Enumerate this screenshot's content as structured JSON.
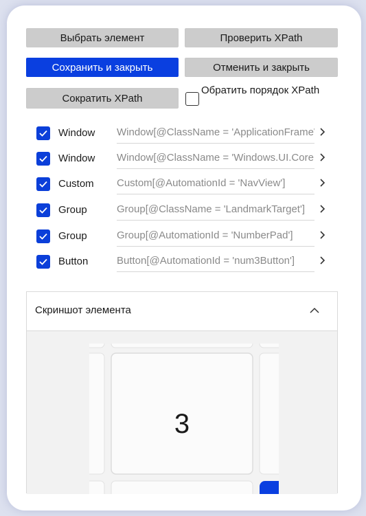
{
  "toolbar": {
    "select_element": "Выбрать элемент",
    "check_xpath": "Проверить XPath",
    "save_close": "Сохранить и закрыть",
    "cancel_close": "Отменить и закрыть",
    "shorten_xpath": "Сократить XPath",
    "reverse_label": "Обратить порядок XPath",
    "reverse_checked": false
  },
  "rows": [
    {
      "type": "Window",
      "path": "Window[@ClassName = 'ApplicationFrameWindow']",
      "checked": true
    },
    {
      "type": "Window",
      "path": "Window[@ClassName = 'Windows.UI.Core.CoreWindow']",
      "checked": true
    },
    {
      "type": "Custom",
      "path": "Custom[@AutomationId = 'NavView']",
      "checked": true
    },
    {
      "type": "Group",
      "path": "Group[@ClassName = 'LandmarkTarget']",
      "checked": true
    },
    {
      "type": "Group",
      "path": "Group[@AutomationId = 'NumberPad']",
      "checked": true
    },
    {
      "type": "Button",
      "path": "Button[@AutomationId = 'num3Button']",
      "checked": true
    }
  ],
  "screenshot_panel": {
    "title": "Скриншот элемента",
    "expanded": true,
    "key_digit": "3"
  },
  "colors": {
    "accent": "#0a3fe0",
    "button_gray": "#cccccc",
    "path_text": "#8a8a8a"
  }
}
